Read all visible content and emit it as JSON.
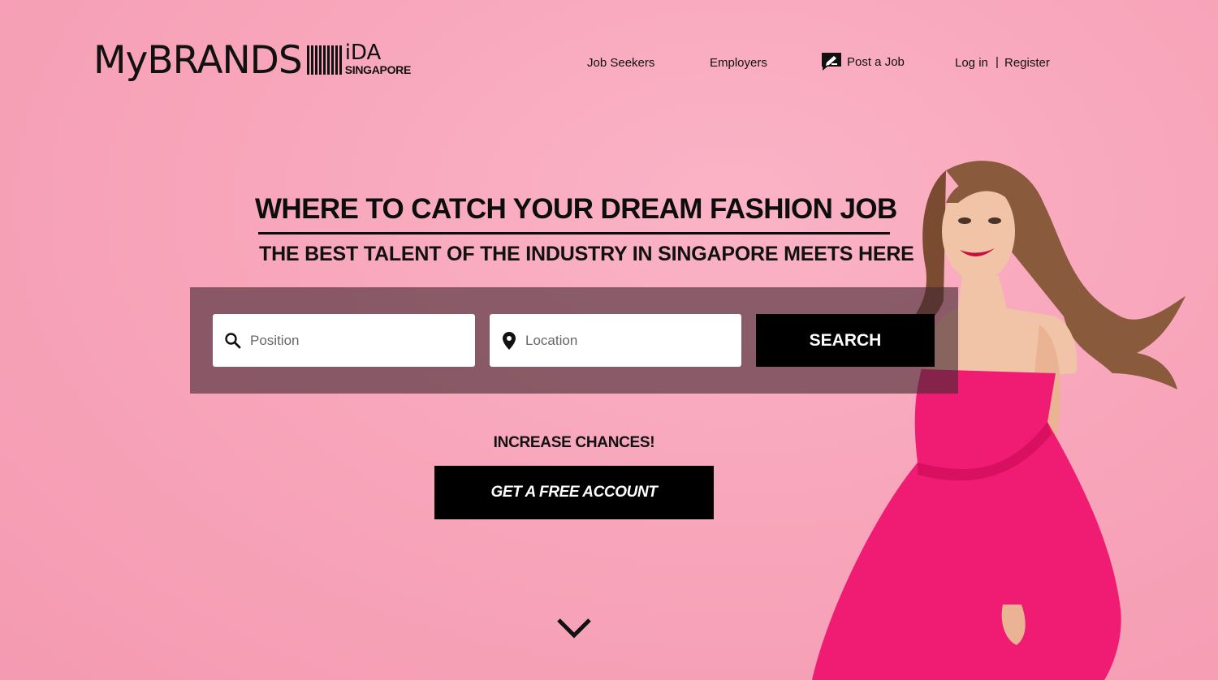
{
  "brand": {
    "name": "MyBRANDS",
    "partner": "iDA",
    "partner_sub": "SINGAPORE"
  },
  "nav": {
    "job_seekers": "Job Seekers",
    "employers": "Employers",
    "post_job": "Post a Job",
    "login": "Log in",
    "separator": "|",
    "register": "Register"
  },
  "hero": {
    "headline": "WHERE TO CATCH YOUR DREAM FASHION JOB",
    "subheadline": "THE BEST TALENT OF THE INDUSTRY IN SINGAPORE MEETS HERE"
  },
  "search": {
    "position_placeholder": "Position",
    "location_placeholder": "Location",
    "button_label": "SEARCH"
  },
  "cta": {
    "label": "INCREASE CHANCES!",
    "button_label": "GET A FREE ACCOUNT"
  },
  "icons": {
    "search": "search-icon",
    "location": "location-pin-icon",
    "post": "post-job-icon",
    "scroll": "chevron-down-icon"
  },
  "colors": {
    "background": "#f8a6bb",
    "panel": "#46283299",
    "button": "#000000",
    "dress": "#f01b73"
  }
}
